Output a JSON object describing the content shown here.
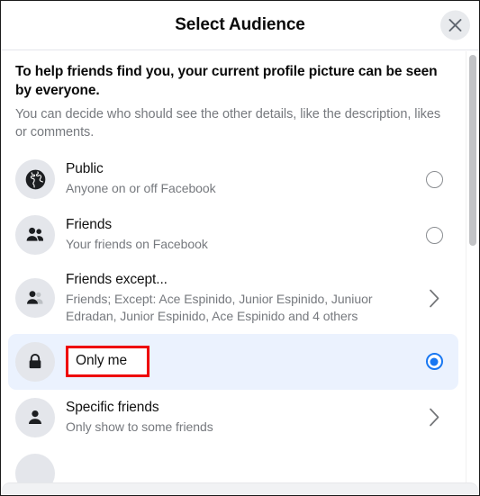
{
  "dialog": {
    "title": "Select Audience",
    "close_icon": "close-icon"
  },
  "intro": {
    "title": "To help friends find you, your current profile picture can be seen by everyone.",
    "subtitle": "You can decide who should see the other details, like the description, likes or comments."
  },
  "colors": {
    "accent": "#1877f2",
    "selected_row_bg": "#ebf2fe",
    "highlight_box": "#ee0000",
    "avatar_bg": "#e4e6eb",
    "muted_text": "#76797e"
  },
  "options": [
    {
      "label": "Public",
      "desc": "Anyone on or off Facebook",
      "icon": "globe-icon",
      "control": "radio",
      "selected": false,
      "highlighted": false
    },
    {
      "label": "Friends",
      "desc": "Your friends on Facebook",
      "icon": "friends-icon",
      "control": "radio",
      "selected": false,
      "highlighted": false
    },
    {
      "label": "Friends except...",
      "desc": "Friends; Except: Ace Espinido, Junior Espinido, Juniuor Edradan, Junior Espinido, Ace Espinido and 4 others",
      "icon": "friends-except-icon",
      "control": "chevron",
      "selected": false,
      "highlighted": false
    },
    {
      "label": "Only me",
      "desc": "",
      "icon": "lock-icon",
      "control": "radio",
      "selected": true,
      "highlighted": true
    },
    {
      "label": "Specific friends",
      "desc": "Only show to some friends",
      "icon": "person-icon",
      "control": "chevron",
      "selected": false,
      "highlighted": false
    }
  ]
}
